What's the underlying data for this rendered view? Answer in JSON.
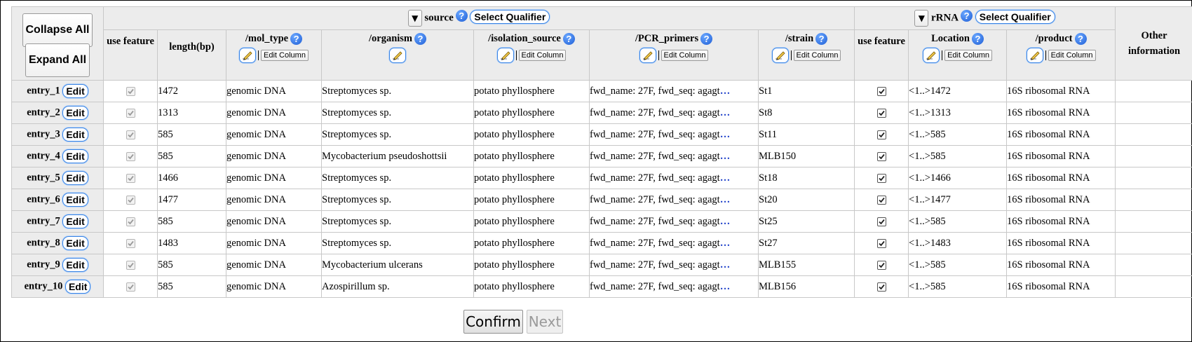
{
  "controls": {
    "collapse_all": "Collapse All",
    "expand_all": "Expand All",
    "edit_column": "Edit Column",
    "edit": "Edit",
    "help": "?",
    "dropdown": "▼"
  },
  "groups": {
    "source": {
      "title": "source",
      "select_qualifier": "Select Qualifier"
    },
    "rrna": {
      "title": "rRNA",
      "select_qualifier": "Select Qualifier"
    },
    "other": "Other information"
  },
  "columns": {
    "use_feature": "use feature",
    "length": "length(bp)",
    "mol_type": "/mol_type",
    "organism": "/organism",
    "isolation_source": "/isolation_source",
    "pcr_primers": "/PCR_primers",
    "strain": "/strain",
    "rrna_use_feature": "use feature",
    "location": "Location",
    "product": "/product"
  },
  "rows": [
    {
      "entry": "entry_1",
      "length": "1472",
      "mol_type": "genomic DNA",
      "organism": "Streptomyces sp.",
      "isolation_source": "potato phyllosphere",
      "pcr_primers": "fwd_name: 27F, fwd_seq: agagt",
      "strain": "St1",
      "location": "<1..>1472",
      "product": "16S ribosomal RNA"
    },
    {
      "entry": "entry_2",
      "length": "1313",
      "mol_type": "genomic DNA",
      "organism": "Streptomyces sp.",
      "isolation_source": "potato phyllosphere",
      "pcr_primers": "fwd_name: 27F, fwd_seq: agagt",
      "strain": "St8",
      "location": "<1..>1313",
      "product": "16S ribosomal RNA"
    },
    {
      "entry": "entry_3",
      "length": "585",
      "mol_type": "genomic DNA",
      "organism": "Streptomyces sp.",
      "isolation_source": "potato phyllosphere",
      "pcr_primers": "fwd_name: 27F, fwd_seq: agagt",
      "strain": "St11",
      "location": "<1..>585",
      "product": "16S ribosomal RNA"
    },
    {
      "entry": "entry_4",
      "length": "585",
      "mol_type": "genomic DNA",
      "organism": "Mycobacterium pseudoshottsii",
      "isolation_source": "potato phyllosphere",
      "pcr_primers": "fwd_name: 27F, fwd_seq: agagt",
      "strain": "MLB150",
      "location": "<1..>585",
      "product": "16S ribosomal RNA"
    },
    {
      "entry": "entry_5",
      "length": "1466",
      "mol_type": "genomic DNA",
      "organism": "Streptomyces sp.",
      "isolation_source": "potato phyllosphere",
      "pcr_primers": "fwd_name: 27F, fwd_seq: agagt",
      "strain": "St18",
      "location": "<1..>1466",
      "product": "16S ribosomal RNA"
    },
    {
      "entry": "entry_6",
      "length": "1477",
      "mol_type": "genomic DNA",
      "organism": "Streptomyces sp.",
      "isolation_source": "potato phyllosphere",
      "pcr_primers": "fwd_name: 27F, fwd_seq: agagt",
      "strain": "St20",
      "location": "<1..>1477",
      "product": "16S ribosomal RNA"
    },
    {
      "entry": "entry_7",
      "length": "585",
      "mol_type": "genomic DNA",
      "organism": "Streptomyces sp.",
      "isolation_source": "potato phyllosphere",
      "pcr_primers": "fwd_name: 27F, fwd_seq: agagt",
      "strain": "St25",
      "location": "<1..>585",
      "product": "16S ribosomal RNA"
    },
    {
      "entry": "entry_8",
      "length": "1483",
      "mol_type": "genomic DNA",
      "organism": "Streptomyces sp.",
      "isolation_source": "potato phyllosphere",
      "pcr_primers": "fwd_name: 27F, fwd_seq: agagt",
      "strain": "St27",
      "location": "<1..>1483",
      "product": "16S ribosomal RNA"
    },
    {
      "entry": "entry_9",
      "length": "585",
      "mol_type": "genomic DNA",
      "organism": "Mycobacterium ulcerans",
      "isolation_source": "potato phyllosphere",
      "pcr_primers": "fwd_name: 27F, fwd_seq: agagt",
      "strain": "MLB155",
      "location": "<1..>585",
      "product": "16S ribosomal RNA"
    },
    {
      "entry": "entry_10",
      "length": "585",
      "mol_type": "genomic DNA",
      "organism": "Azospirillum sp.",
      "isolation_source": "potato phyllosphere",
      "pcr_primers": "fwd_name: 27F, fwd_seq: agagt",
      "strain": "MLB156",
      "location": "<1..>585",
      "product": "16S ribosomal RNA"
    }
  ],
  "pcr_ellipsis": "…",
  "footer": {
    "confirm": "Confirm",
    "next": "Next"
  },
  "icons": {
    "help": "question-circle-icon",
    "pencil": "pencil-icon",
    "dropdown": "dropdown-triangle-icon",
    "checkbox": "checkbox-icon"
  },
  "colors": {
    "header_bg": "#ececec",
    "border": "#c8c8c8",
    "accent_blue": "#3a84e4",
    "ellipsis": "#1a3cc8"
  }
}
